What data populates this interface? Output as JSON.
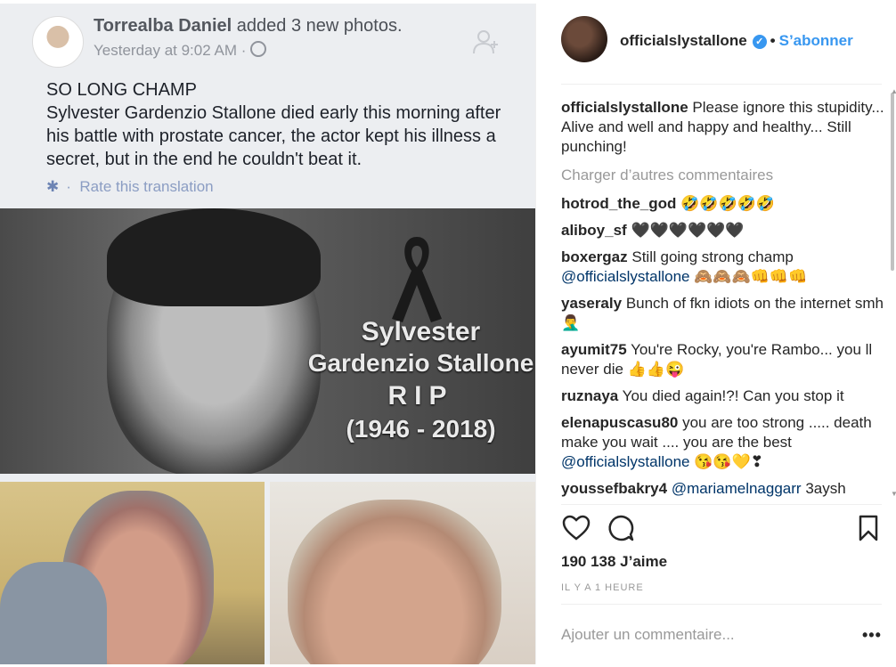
{
  "facebook_post": {
    "author": "Torrealba Daniel",
    "action": "added 3 new photos.",
    "time": "Yesterday at 9:02 AM ·",
    "title": "SO LONG CHAMP",
    "body": "Sylvester Gardenzio Stallone died early this morning after his battle with prostate cancer, the actor kept his illness a secret, but in the end he couldn't beat it.",
    "translate_dot": "·",
    "translate_link": "Rate this translation",
    "rip": {
      "line1": "Sylvester",
      "line2": "Gardenzio Stallone",
      "line3": "RIP",
      "line4": "(1946 - 2018)"
    }
  },
  "instagram": {
    "username": "officialslystallone",
    "follow_label": "S’abonner",
    "caption": "Please ignore this stupidity... Alive and well and happy and healthy... Still punching!",
    "load_more": "Charger d’autres commentaires",
    "comments": [
      {
        "user": "hotrod_the_god",
        "text": "🤣🤣🤣🤣🤣"
      },
      {
        "user": "aliboy_sf",
        "text": "🖤🖤🖤🖤🖤🖤"
      },
      {
        "user": "boxergaz",
        "text": "Still going strong champ",
        "mention": "@officialslystallone",
        "after": "🙈🙈🙈👊👊👊"
      },
      {
        "user": "yaseraly",
        "text": "Bunch of fkn idiots on the internet smh 🤦‍♂️"
      },
      {
        "user": "ayumit75",
        "text": "You're Rocky, you're Rambo... you ll never die 👍👍😜"
      },
      {
        "user": "ruznaya",
        "text": "You died again!?! Can you stop it"
      },
      {
        "user": "elenapuscasu80",
        "text": "you are too strong ..... death make you wait .... you are the best",
        "mention": "@officialslystallone",
        "after": "😘😘💛❣"
      },
      {
        "user": "youssefbakry4",
        "text": "",
        "mention": "@mariamelnaggarr",
        "after": "3aysh"
      }
    ],
    "likes": "190 138 J’aime",
    "timestamp": "IL Y A 1 HEURE",
    "add_comment_placeholder": "Ajouter un commentaire...",
    "more_label": "•••"
  },
  "colors": {
    "ig_blue": "#3897f0",
    "fb_link": "#8b9dc3",
    "mention": "#003569"
  }
}
